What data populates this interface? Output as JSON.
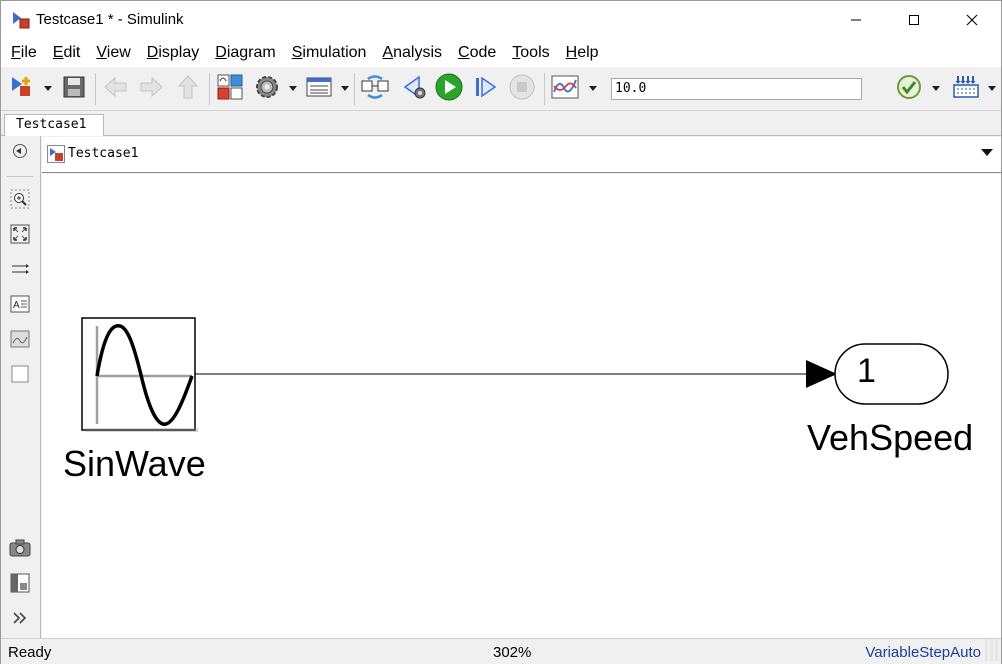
{
  "window": {
    "title": "Testcase1 * - Simulink"
  },
  "menu": [
    {
      "label": "File",
      "accel": "F",
      "rest": "ile"
    },
    {
      "label": "Edit",
      "accel": "E",
      "rest": "dit"
    },
    {
      "label": "View",
      "accel": "V",
      "rest": "iew"
    },
    {
      "label": "Display",
      "accel": "D",
      "rest": "isplay"
    },
    {
      "label": "Diagram",
      "accel": "D",
      "rest": "iagram"
    },
    {
      "label": "Simulation",
      "accel": "S",
      "rest": "imulation"
    },
    {
      "label": "Analysis",
      "accel": "A",
      "rest": "nalysis"
    },
    {
      "label": "Code",
      "accel": "C",
      "rest": "ode"
    },
    {
      "label": "Tools",
      "accel": "T",
      "rest": "ools"
    },
    {
      "label": "Help",
      "accel": "H",
      "rest": "elp"
    }
  ],
  "toolbar": {
    "stop_time": "10.0",
    "overflow": "»",
    "icons": [
      "new-model-icon",
      "save-icon",
      "back-icon",
      "forward-icon",
      "up-icon",
      "library-browser-icon",
      "model-settings-icon",
      "model-explorer-icon",
      "update-diagram-icon",
      "step-back-icon",
      "run-icon",
      "step-forward-icon",
      "stop-icon",
      "data-inspector-icon",
      "model-advisor-icon",
      "build-icon"
    ],
    "colors": {
      "run": "#2aa52a",
      "step": "#3a6fd0"
    }
  },
  "tabs": [
    {
      "label": "Testcase1"
    }
  ],
  "explorer": {
    "path": "Testcase1"
  },
  "diagram": {
    "blocks": [
      {
        "name": "SinWave",
        "type": "sine-wave-source"
      },
      {
        "name": "VehSpeed",
        "type": "outport",
        "port_number": "1"
      }
    ]
  },
  "status": {
    "state": "Ready",
    "zoom": "302%",
    "solver": "VariableStepAuto"
  }
}
